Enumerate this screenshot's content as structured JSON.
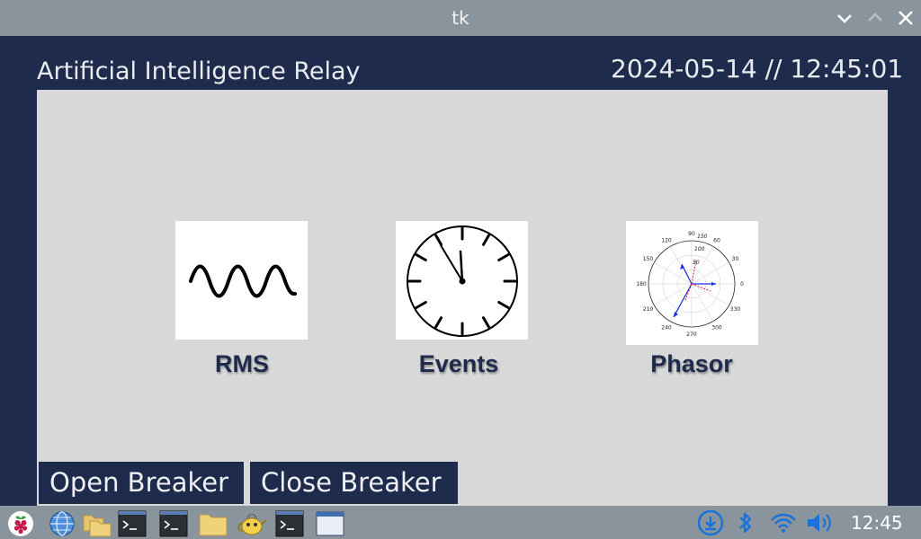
{
  "window": {
    "title": "tk"
  },
  "app": {
    "title": "Artificial Intelligence Relay",
    "datetime": "2024-05-14 // 12:45:01"
  },
  "tiles": [
    {
      "label": "RMS",
      "icon": "sine-wave-icon"
    },
    {
      "label": "Events",
      "icon": "clock-icon"
    },
    {
      "label": "Phasor",
      "icon": "polar-plot-icon"
    }
  ],
  "phasor_plot": {
    "angle_labels": [
      "90",
      "60",
      "30",
      "0",
      "330",
      "300",
      "270",
      "240",
      "210",
      "180",
      "150",
      "120"
    ],
    "radius_labels": [
      "50",
      "100",
      "150"
    ]
  },
  "buttons": {
    "open_breaker": "Open Breaker",
    "close_breaker": "Close Breaker"
  },
  "taskbar": {
    "time": "12:45"
  },
  "colors": {
    "dark_navy": "#1f2b4c",
    "panel_gray": "#d8d8d8",
    "chrome_gray": "#8a949c",
    "tray_blue": "#1a73d9"
  }
}
